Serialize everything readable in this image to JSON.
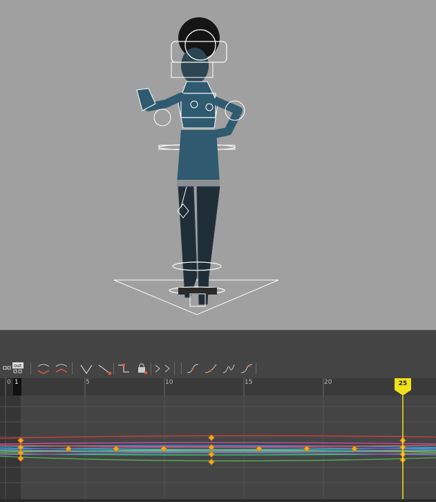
{
  "viewport": {
    "description_icon": "character-rig-icon"
  },
  "toolbar": {
    "buttons": [
      {
        "name": "key-select-icon"
      },
      {
        "name": "out-tangent-icon",
        "label": "out"
      },
      {
        "name": "flat-tangent-icon"
      },
      {
        "name": "weighted-tangent-icon"
      },
      {
        "name": "linear-tangent-icon"
      },
      {
        "name": "clamped-tangent-icon"
      },
      {
        "name": "step-tangent-icon"
      },
      {
        "name": "lock-tangent-icon"
      },
      {
        "name": "break-tangent-icon"
      },
      {
        "name": "unify-tangent-icon"
      },
      {
        "name": "auto-tangent-icon"
      },
      {
        "name": "spline-tangent-icon"
      },
      {
        "name": "plateau-tangent-icon"
      },
      {
        "name": "stepped-next-icon"
      }
    ]
  },
  "timeline": {
    "ruler_labels": [
      "0",
      "1",
      "5",
      "10",
      "15",
      "20",
      "25"
    ],
    "current_frame": "25",
    "colors": {
      "accent": "#f2e01a",
      "key": "#f5a623"
    }
  }
}
